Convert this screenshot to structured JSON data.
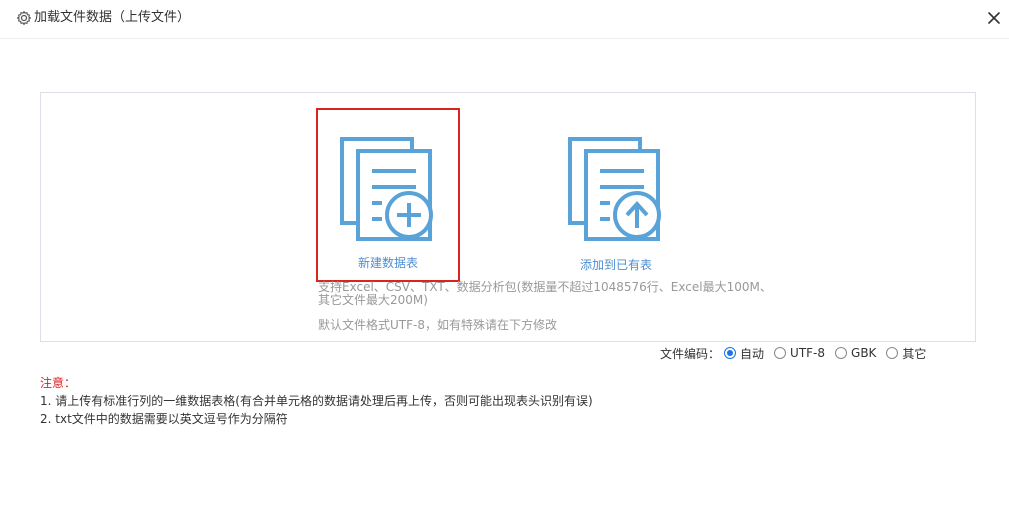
{
  "header": {
    "title": "加载文件数据（上传文件）",
    "settings_icon": "gear-icon",
    "close_icon": "close-icon"
  },
  "options": {
    "new_table": {
      "label": "新建数据表",
      "icon": "document-add-icon",
      "selected": true
    },
    "append_table": {
      "label": "添加到已有表",
      "icon": "document-upload-icon"
    }
  },
  "info": {
    "support_line1": "支持Excel、CSV、TXT、数据分析包(数据量不超过1048576行、Excel最大100M、",
    "support_line2": "其它文件最大200M)",
    "default_format": "默认文件格式UTF-8，如有特殊请在下方修改"
  },
  "encoding": {
    "label": "文件编码：",
    "options": [
      "自动",
      "UTF-8",
      "GBK",
      "其它"
    ],
    "selected": "自动"
  },
  "notes": {
    "title": "注意：",
    "items": [
      "1. 请上传有标准行列的一维数据表格(有合并单元格的数据请处理后再上传，否则可能出现表头识别有误)",
      "2. txt文件中的数据需要以英文逗号作为分隔符"
    ]
  },
  "colors": {
    "icon_blue": "#5aa3d8",
    "label_blue": "#4d8fd2",
    "selection_red": "#d9261c",
    "notes_red": "#e02020",
    "radio_blue": "#1a73e8"
  }
}
